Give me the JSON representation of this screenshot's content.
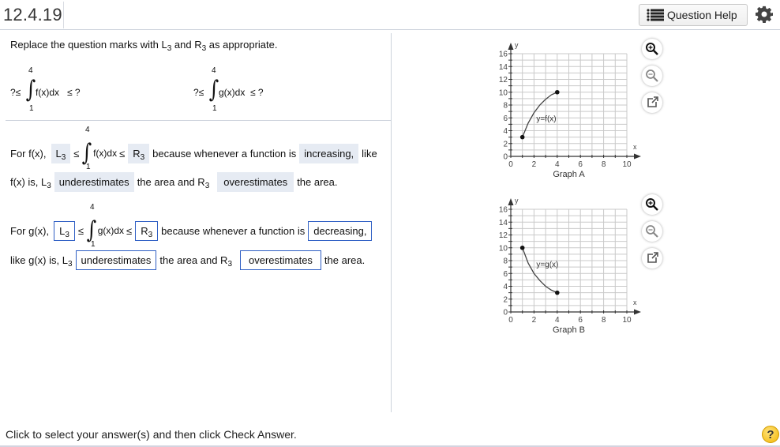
{
  "header": {
    "question_number": "12.4.19",
    "help_button_label": "Question Help",
    "help_icon": "list-icon",
    "settings_icon": "gear-icon"
  },
  "instruction": {
    "prefix": "Replace the question marks with ",
    "L": "L",
    "sub": "3",
    "mid": " and ",
    "R": "R",
    "suffix": " as appropriate."
  },
  "given": {
    "f": {
      "left": "?≤",
      "upper": "4",
      "lower": "1",
      "integrand": "f(x)dx",
      "right": "≤ ?"
    },
    "g": {
      "left": "?≤",
      "upper": "4",
      "lower": "1",
      "integrand": "g(x)dx",
      "right": "≤ ?"
    }
  },
  "answer_f": {
    "lead": "For f(x),",
    "box1_L": "L",
    "box1_sub": "3",
    "leq1": "≤",
    "upper": "4",
    "lower": "1",
    "integrand": "f(x)dx",
    "leq2": "≤",
    "box2_R": "R",
    "box2_sub": "3",
    "because": "because whenever a function is",
    "box3": "increasing,",
    "like": "like",
    "line2_lead": "f(x) is, L",
    "line2_sub": "3",
    "box4": "underestimates",
    "mid": "the area and R",
    "mid_sub": "3",
    "box5": "overestimates",
    "tail": "the area."
  },
  "answer_g": {
    "lead": "For g(x),",
    "box1_L": "L",
    "box1_sub": "3",
    "leq1": "≤",
    "upper": "4",
    "lower": "1",
    "integrand": "g(x)dx",
    "leq2": "≤",
    "box2_R": "R",
    "box2_sub": "3",
    "because": "because whenever a function is",
    "box3": "decreasing,",
    "line2_lead": "like g(x) is, L",
    "line2_sub": "3",
    "box4": "underestimates",
    "mid": "the area and R",
    "mid_sub": "3",
    "box5": "overestimates",
    "tail": "the area."
  },
  "graph_controls": {
    "zoom_in_icon": "zoom-in-icon",
    "zoom_out_icon": "zoom-out-icon",
    "popout_icon": "external-link-icon"
  },
  "chart_data": [
    {
      "type": "line",
      "title": "Graph A",
      "xlabel": "x",
      "ylabel": "y",
      "xlim": [
        0,
        10
      ],
      "ylim": [
        0,
        16
      ],
      "xticks": [
        "0",
        "2",
        "4",
        "6",
        "8",
        "10"
      ],
      "yticks": [
        "0",
        "2",
        "4",
        "6",
        "8",
        "10",
        "12",
        "14",
        "16"
      ],
      "grid": true,
      "curve_label": "y=f(x)",
      "series": [
        {
          "name": "y=f(x)",
          "points": [
            [
              1,
              3
            ],
            [
              1.5,
              5.2
            ],
            [
              2,
              6.8
            ],
            [
              2.5,
              8
            ],
            [
              3,
              8.9
            ],
            [
              3.5,
              9.6
            ],
            [
              4,
              10
            ]
          ]
        }
      ],
      "endpoints": [
        [
          1,
          3
        ],
        [
          4,
          10
        ]
      ]
    },
    {
      "type": "line",
      "title": "Graph B",
      "xlabel": "x",
      "ylabel": "y",
      "xlim": [
        0,
        10
      ],
      "ylim": [
        0,
        16
      ],
      "xticks": [
        "0",
        "2",
        "4",
        "6",
        "8",
        "10"
      ],
      "yticks": [
        "0",
        "2",
        "4",
        "6",
        "8",
        "10",
        "12",
        "14",
        "16"
      ],
      "grid": true,
      "curve_label": "y=g(x)",
      "series": [
        {
          "name": "y=g(x)",
          "points": [
            [
              1,
              10
            ],
            [
              1.5,
              7.6
            ],
            [
              2,
              6
            ],
            [
              2.5,
              4.9
            ],
            [
              3,
              4
            ],
            [
              3.5,
              3.4
            ],
            [
              4,
              3
            ]
          ]
        }
      ],
      "endpoints": [
        [
          1,
          10
        ],
        [
          4,
          3
        ]
      ]
    }
  ],
  "footer": {
    "status_text": "Click to select your answer(s) and then click Check Answer.",
    "help_icon": "question-mark-icon",
    "help_glyph": "?"
  },
  "colors": {
    "filled_box_bg": "#e6ebf3",
    "outlined_box_border": "#2f5fc4",
    "divider": "#cdd3dc"
  }
}
